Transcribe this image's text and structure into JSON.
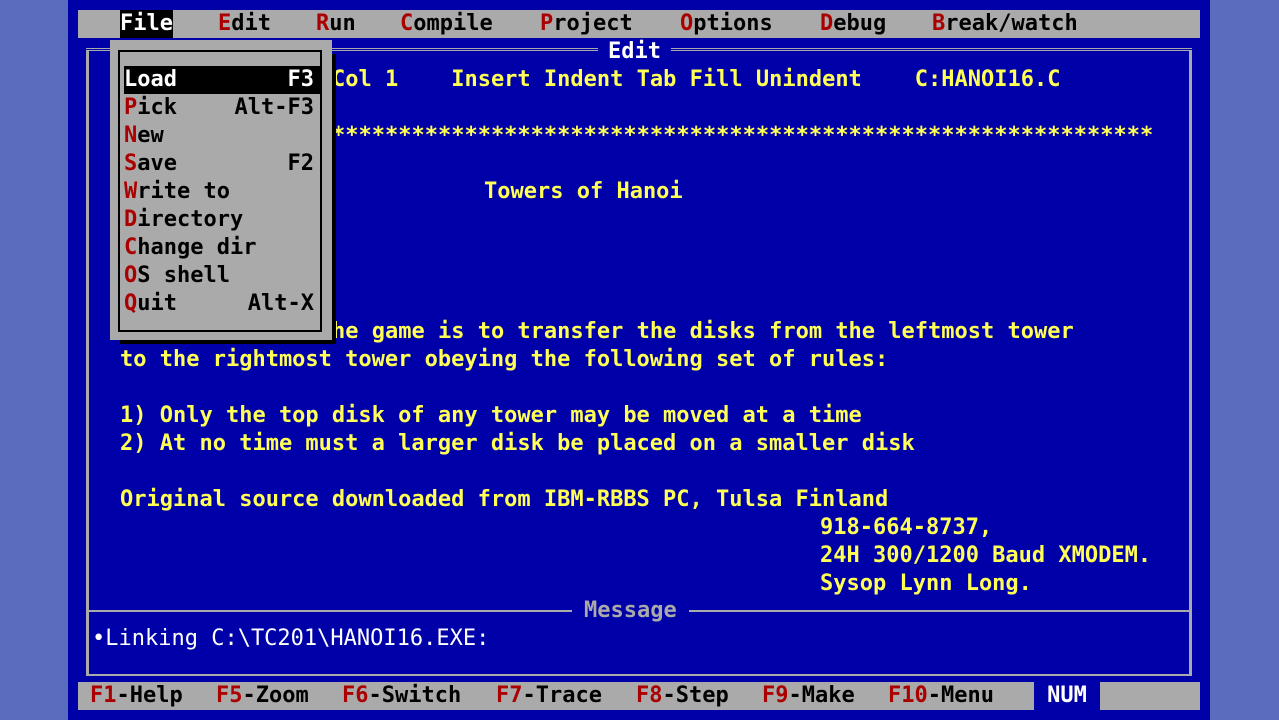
{
  "menubar": {
    "items": [
      {
        "hot": "F",
        "rest": "ile"
      },
      {
        "hot": "E",
        "rest": "dit"
      },
      {
        "hot": "R",
        "rest": "un"
      },
      {
        "hot": "C",
        "rest": "ompile"
      },
      {
        "hot": "P",
        "rest": "roject"
      },
      {
        "hot": "O",
        "rest": "ptions"
      },
      {
        "hot": "D",
        "rest": "ebug"
      },
      {
        "hot": "B",
        "rest": "reak/watch"
      }
    ]
  },
  "editor": {
    "title": "Edit",
    "status": "Col 1    Insert Indent Tab Fill Unindent    C:HANOI16.C",
    "separator": "**************************************************************",
    "lines": {
      "heading": "Towers of Hanoi",
      "p1": "he game is to transfer the disks from the leftmost tower",
      "p2": "to the rightmost tower obeying the following set of rules:",
      "r1": "1) Only the top disk of any tower may be moved at a time",
      "r2": "2) At no time must a larger disk be placed on a smaller disk",
      "s1": "Original source downloaded from IBM-RBBS PC, Tulsa Finland",
      "s2": "918-664-8737,",
      "s3": "24H 300/1200 Baud XMODEM.",
      "s4": "Sysop Lynn Long."
    }
  },
  "file_menu": {
    "items": [
      {
        "hot": "L",
        "rest": "oad",
        "accel": "F3"
      },
      {
        "hot": "P",
        "rest": "ick",
        "accel": "Alt-F3"
      },
      {
        "hot": "N",
        "rest": "ew",
        "accel": ""
      },
      {
        "hot": "S",
        "rest": "ave",
        "accel": "F2"
      },
      {
        "hot": "W",
        "rest": "rite to",
        "accel": ""
      },
      {
        "hot": "D",
        "rest": "irectory",
        "accel": ""
      },
      {
        "hot": "C",
        "rest": "hange dir",
        "accel": ""
      },
      {
        "hot": "O",
        "rest": "S shell",
        "accel": ""
      },
      {
        "hot": "Q",
        "rest": "uit",
        "accel": "Alt-X"
      }
    ]
  },
  "message": {
    "title": "Message",
    "text": "•Linking C:\\TC201\\HANOI16.EXE:"
  },
  "fkeys": [
    {
      "key": "F1",
      "label": "-Help"
    },
    {
      "key": "F5",
      "label": "-Zoom"
    },
    {
      "key": "F6",
      "label": "-Switch"
    },
    {
      "key": "F7",
      "label": "-Trace"
    },
    {
      "key": "F8",
      "label": "-Step"
    },
    {
      "key": "F9",
      "label": "-Make"
    },
    {
      "key": "F10",
      "label": "-Menu"
    }
  ],
  "indicator": "NUM",
  "colors": {
    "background": "#0000a8",
    "menu_bg": "#aaaaaa",
    "hotkey": "#aa0000",
    "text": "#ffff55"
  }
}
